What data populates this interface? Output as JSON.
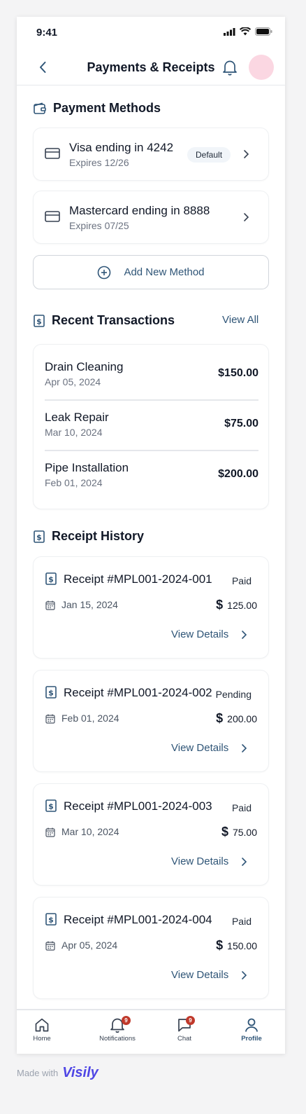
{
  "status_bar": {
    "time": "9:41"
  },
  "header": {
    "title": "Payments & Receipts"
  },
  "payment_methods": {
    "title": "Payment Methods",
    "cards": [
      {
        "name": "Visa ending in 4242",
        "expires": "Expires 12/26",
        "badge": "Default"
      },
      {
        "name": "Mastercard ending in 8888",
        "expires": "Expires 07/25"
      }
    ],
    "add_label": "Add New Method"
  },
  "recent_transactions": {
    "title": "Recent Transactions",
    "view_all": "View All",
    "items": [
      {
        "name": "Drain Cleaning",
        "date": "Apr 05, 2024",
        "amount": "$150.00"
      },
      {
        "name": "Leak Repair",
        "date": "Mar 10, 2024",
        "amount": "$75.00"
      },
      {
        "name": "Pipe Installation",
        "date": "Feb 01, 2024",
        "amount": "$200.00"
      }
    ]
  },
  "receipt_history": {
    "title": "Receipt History",
    "receipts": [
      {
        "title": "Receipt #MPL001-2024-001",
        "status": "Paid",
        "date": "Jan 15, 2024",
        "currency": "$",
        "amount": "125.00",
        "link": "View Details"
      },
      {
        "title": "Receipt #MPL001-2024-002",
        "status": "Pending",
        "date": "Feb 01, 2024",
        "currency": "$",
        "amount": "200.00",
        "link": "View Details"
      },
      {
        "title": "Receipt #MPL001-2024-003",
        "status": "Paid",
        "date": "Mar 10, 2024",
        "currency": "$",
        "amount": "75.00",
        "link": "View Details"
      },
      {
        "title": "Receipt #MPL001-2024-004",
        "status": "Paid",
        "date": "Apr 05, 2024",
        "currency": "$",
        "amount": "150.00",
        "link": "View Details"
      }
    ]
  },
  "bottom_nav": {
    "items": [
      {
        "label": "Home",
        "icon": "home-icon"
      },
      {
        "label": "Notifications",
        "icon": "bell-icon",
        "badge": "9"
      },
      {
        "label": "Chat",
        "icon": "chat-icon",
        "badge": "9"
      },
      {
        "label": "Profile",
        "icon": "user-icon",
        "active": true
      }
    ]
  },
  "footer": {
    "made_with": "Made with",
    "brand": "Visily"
  },
  "colors": {
    "accent": "#2f5577",
    "badge_red": "#c0392b",
    "avatar_pink": "#fbd7e2"
  }
}
